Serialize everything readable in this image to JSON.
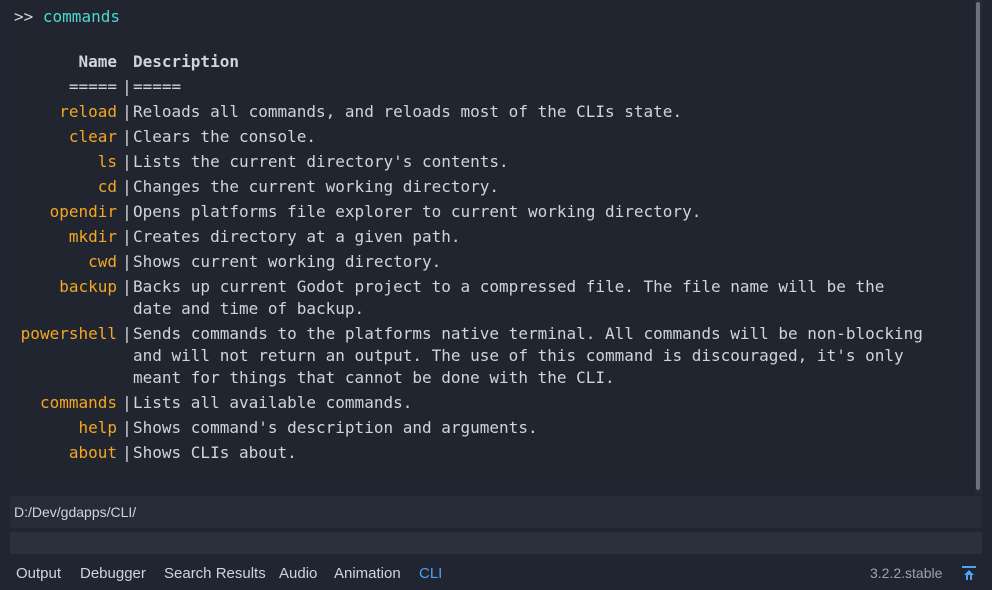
{
  "console": {
    "prompt_marker": ">>",
    "prompt_command": "commands",
    "table": {
      "header": {
        "name": "Name",
        "description": "Description"
      },
      "divider": {
        "name": "=====",
        "description": "====="
      },
      "separator": "|",
      "rows": [
        {
          "name": "reload",
          "description": "Reloads all commands, and reloads most of the CLIs state."
        },
        {
          "name": "clear",
          "description": "Clears the console."
        },
        {
          "name": "ls",
          "description": "Lists the current directory's contents."
        },
        {
          "name": "cd",
          "description": "Changes the current working directory."
        },
        {
          "name": "opendir",
          "description": "Opens platforms file explorer to current working directory."
        },
        {
          "name": "mkdir",
          "description": "Creates directory at a given path."
        },
        {
          "name": "cwd",
          "description": "Shows current working directory."
        },
        {
          "name": "backup",
          "description": "Backs up current Godot project to a compressed file. The file name will be the\ndate and time of backup."
        },
        {
          "name": "powershell",
          "description": "Sends commands to the platforms native terminal. All commands will be non-blocking\nand will not return an output. The use of this command is discouraged, it's only\nmeant for things that cannot be done with the CLI."
        },
        {
          "name": "commands",
          "description": "Lists all available commands."
        },
        {
          "name": "help",
          "description": "Shows command's description and arguments."
        },
        {
          "name": "about",
          "description": "Shows CLIs about."
        }
      ]
    }
  },
  "path_bar": {
    "text": "D:/Dev/gdapps/CLI/"
  },
  "input": {
    "value": "",
    "placeholder": ""
  },
  "bottom_panel": {
    "tabs": [
      "Output",
      "Debugger",
      "Search Results",
      "Audio",
      "Animation",
      "CLI"
    ],
    "active_tab": "CLI",
    "version": "3.2.2.stable",
    "pin_icon": "pin-panel-icon"
  },
  "colors": {
    "background": "#202531",
    "command_name": "#f5a623",
    "prompt_command": "#4cd9d2",
    "text": "#d1d4d9",
    "active_tab": "#4fa3f5"
  }
}
